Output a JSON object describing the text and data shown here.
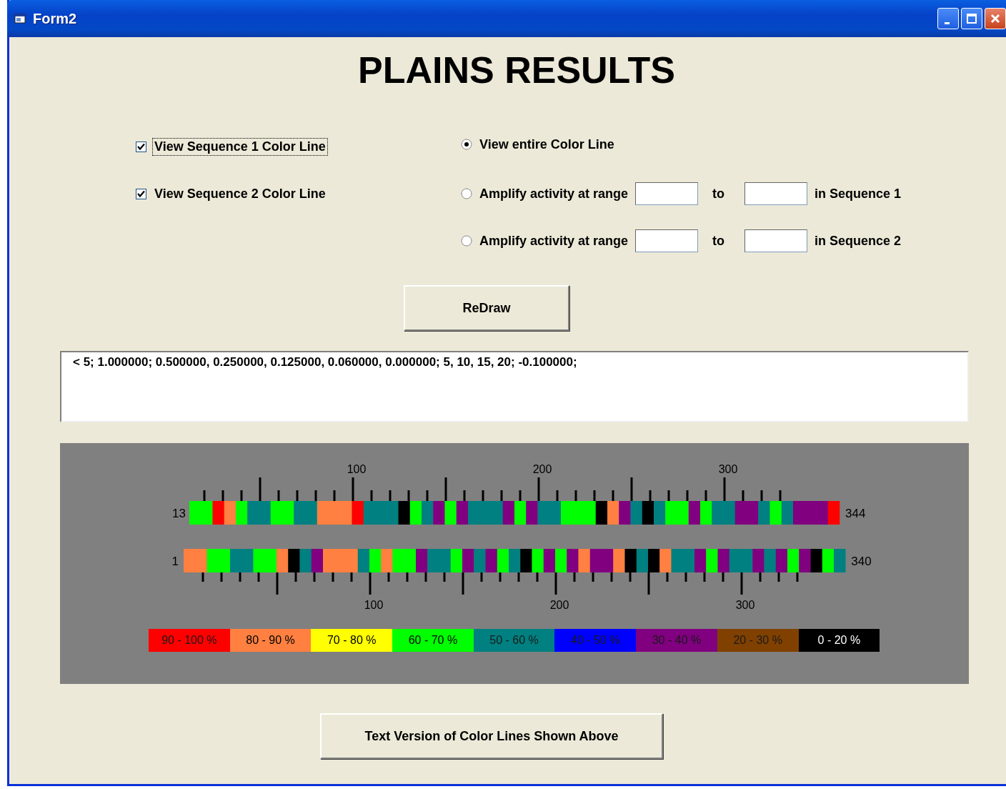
{
  "window": {
    "title": "Form2"
  },
  "heading": "PLAINS RESULTS",
  "checkboxes": [
    {
      "label": "View Sequence 1 Color Line",
      "checked": true,
      "focused": true
    },
    {
      "label": "View Sequence 2 Color Line",
      "checked": true,
      "focused": false
    }
  ],
  "view_options": [
    {
      "kind": "plain",
      "label": "View entire Color Line",
      "selected": true
    },
    {
      "kind": "range",
      "label": "Amplify activity at range",
      "to_label": "to",
      "suffix": "in Sequence 1",
      "selected": false
    },
    {
      "kind": "range",
      "label": "Amplify activity at range",
      "to_label": "to",
      "suffix": "in Sequence 2",
      "selected": false
    }
  ],
  "redraw_button": "ReDraw",
  "output_text": "< 5; 1.000000; 0.500000, 0.250000, 0.125000, 0.060000, 0.000000; 5, 10, 15, 20; -0.100000;",
  "color_lines": {
    "top_axis_labels": [
      "100",
      "200",
      "300"
    ],
    "bottom_axis_labels": [
      "100",
      "200",
      "300"
    ],
    "sequences": [
      {
        "start": "13",
        "end": "344",
        "units": [
          {
            "color": "#00ff00"
          },
          {
            "color": "#00ff00"
          },
          {
            "color": "#ff0000"
          },
          {
            "color": "#ff8040"
          },
          {
            "color": "#00ff00"
          },
          {
            "color": "#008080"
          },
          {
            "color": "#008080"
          },
          {
            "color": "#00ff00"
          },
          {
            "color": "#00ff00"
          },
          {
            "color": "#008080"
          },
          {
            "color": "#008080"
          },
          {
            "color": "#ff8040"
          },
          {
            "color": "#ff8040"
          },
          {
            "color": "#ff8040"
          },
          {
            "color": "#ff0000"
          },
          {
            "color": "#008080"
          },
          {
            "color": "#008080"
          },
          {
            "color": "#008080"
          },
          {
            "color": "#000000"
          },
          {
            "color": "#00ff00"
          },
          {
            "color": "#008080"
          },
          {
            "color": "#800080"
          },
          {
            "color": "#00ff00"
          },
          {
            "color": "#800080"
          },
          {
            "color": "#008080"
          },
          {
            "color": "#008080"
          },
          {
            "color": "#008080"
          },
          {
            "color": "#800080"
          },
          {
            "color": "#00ff00"
          },
          {
            "color": "#800080"
          },
          {
            "color": "#008080"
          },
          {
            "color": "#008080"
          },
          {
            "color": "#00ff00"
          },
          {
            "color": "#00ff00"
          },
          {
            "color": "#00ff00"
          },
          {
            "color": "#000000"
          },
          {
            "color": "#ff8040"
          },
          {
            "color": "#800080"
          },
          {
            "color": "#008080"
          },
          {
            "color": "#000000"
          },
          {
            "color": "#008080"
          },
          {
            "color": "#00ff00"
          },
          {
            "color": "#00ff00"
          },
          {
            "color": "#800080"
          },
          {
            "color": "#00ff00"
          },
          {
            "color": "#008080"
          },
          {
            "color": "#008080"
          },
          {
            "color": "#800080"
          },
          {
            "color": "#800080"
          },
          {
            "color": "#008080"
          },
          {
            "color": "#00ff00"
          },
          {
            "color": "#008080"
          },
          {
            "color": "#800080"
          },
          {
            "color": "#800080"
          },
          {
            "color": "#800080"
          },
          {
            "color": "#ff0000"
          }
        ]
      },
      {
        "start": "1",
        "end": "340",
        "units": [
          {
            "color": "#ff8040"
          },
          {
            "color": "#ff8040"
          },
          {
            "color": "#00ff00"
          },
          {
            "color": "#00ff00"
          },
          {
            "color": "#008080"
          },
          {
            "color": "#008080"
          },
          {
            "color": "#00ff00"
          },
          {
            "color": "#00ff00"
          },
          {
            "color": "#ff8040"
          },
          {
            "color": "#000000"
          },
          {
            "color": "#008080"
          },
          {
            "color": "#800080"
          },
          {
            "color": "#ff8040"
          },
          {
            "color": "#ff8040"
          },
          {
            "color": "#ff8040"
          },
          {
            "color": "#008080"
          },
          {
            "color": "#00ff00"
          },
          {
            "color": "#ff8040"
          },
          {
            "color": "#00ff00"
          },
          {
            "color": "#00ff00"
          },
          {
            "color": "#800080"
          },
          {
            "color": "#008080"
          },
          {
            "color": "#008080"
          },
          {
            "color": "#00ff00"
          },
          {
            "color": "#800080"
          },
          {
            "color": "#008080"
          },
          {
            "color": "#800080"
          },
          {
            "color": "#00ff00"
          },
          {
            "color": "#008080"
          },
          {
            "color": "#000000"
          },
          {
            "color": "#00ff00"
          },
          {
            "color": "#800080"
          },
          {
            "color": "#00ff00"
          },
          {
            "color": "#800080"
          },
          {
            "color": "#ff8040"
          },
          {
            "color": "#800080"
          },
          {
            "color": "#800080"
          },
          {
            "color": "#ff8040"
          },
          {
            "color": "#000000"
          },
          {
            "color": "#008080"
          },
          {
            "color": "#000000"
          },
          {
            "color": "#ff8040"
          },
          {
            "color": "#008080"
          },
          {
            "color": "#008080"
          },
          {
            "color": "#800080"
          },
          {
            "color": "#00ff00"
          },
          {
            "color": "#800080"
          },
          {
            "color": "#008080"
          },
          {
            "color": "#008080"
          },
          {
            "color": "#800080"
          },
          {
            "color": "#008080"
          },
          {
            "color": "#800080"
          },
          {
            "color": "#00ff00"
          },
          {
            "color": "#800080"
          },
          {
            "color": "#000000"
          },
          {
            "color": "#00ff00"
          },
          {
            "color": "#008080"
          }
        ]
      }
    ]
  },
  "legend": [
    {
      "label": "90 - 100 %",
      "color": "#ff0000"
    },
    {
      "label": "80 - 90 %",
      "color": "#ff8040"
    },
    {
      "label": "70 - 80 %",
      "color": "#ffff00"
    },
    {
      "label": "60 - 70 %",
      "color": "#00ff00"
    },
    {
      "label": "50 - 60 %",
      "color": "#008080"
    },
    {
      "label": "40 - 50 %",
      "color": "#0000ff"
    },
    {
      "label": "30 - 40 %",
      "color": "#800080"
    },
    {
      "label": "20 - 30 %",
      "color": "#804000"
    },
    {
      "label": "0 - 20 %",
      "color": "#000000"
    }
  ],
  "text_version_button": "Text Version of Color Lines Shown Above"
}
